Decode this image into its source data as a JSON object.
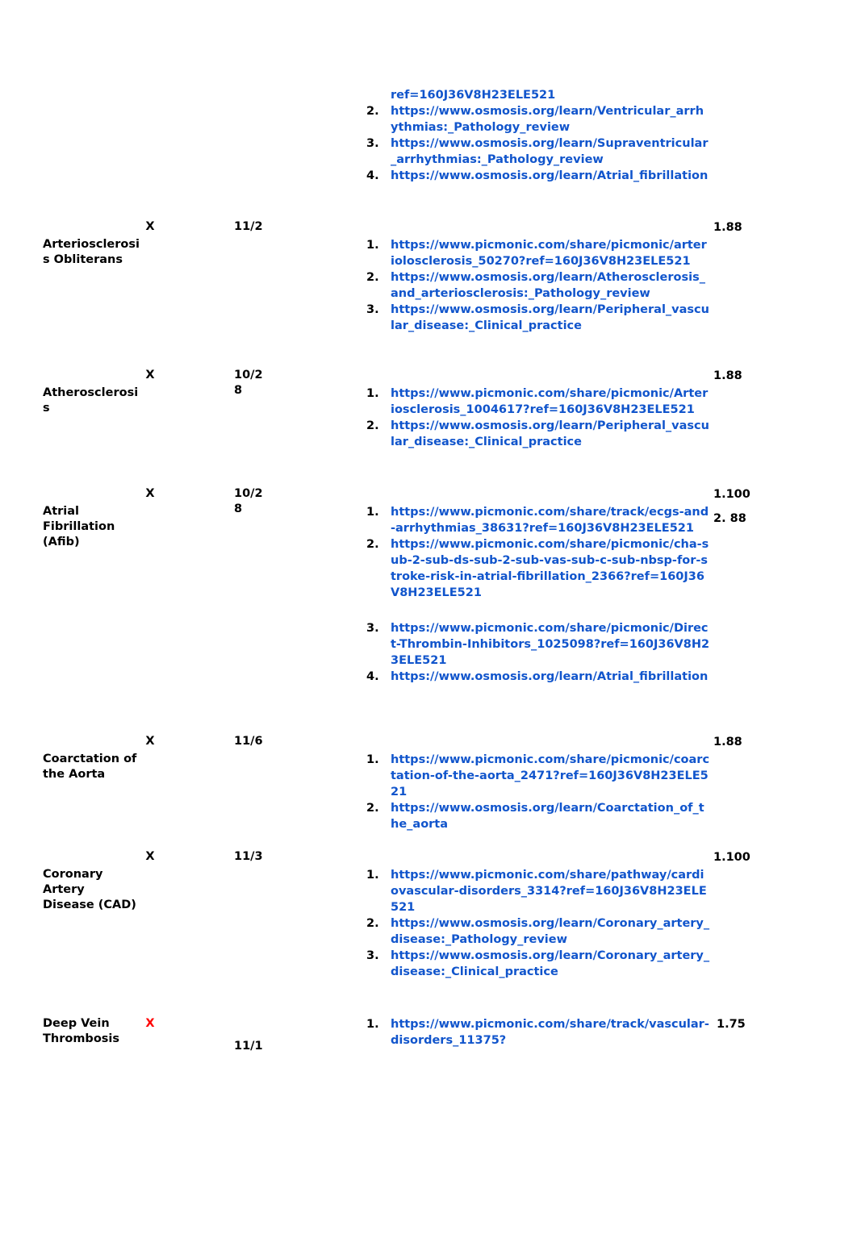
{
  "colors": {
    "link": "#1155cc",
    "text": "#000000",
    "flag_red": "#ff0000",
    "background": "#ffffff"
  },
  "rows": [
    {
      "id": "continuation",
      "topic": "",
      "mark": "",
      "date": "",
      "score": "",
      "links": [
        {
          "num": "",
          "url": "ref=160J36V8H23ELE521",
          "continuation": true
        },
        {
          "num": "2.",
          "url": "https://www.osmosis.org/learn/Ventricular_arrhythmias:_Pathology_review"
        },
        {
          "num": "3.",
          "url": "https://www.osmosis.org/learn/Supraventricular_arrhythmias:_Pathology_review"
        },
        {
          "num": "4.",
          "url": "https://www.osmosis.org/learn/Atrial_fibrillation"
        }
      ]
    },
    {
      "id": "arteriosclerosis-obliterans",
      "topic": "Arteriosclerosis Obliterans",
      "mark": "X",
      "mark_color": "black",
      "date": "11/2",
      "score": "1.88",
      "links": [
        {
          "num": "1.",
          "url": "https://www.picmonic.com/share/picmonic/arteriolosclerosis_50270?ref=160J36V8H23ELE521"
        },
        {
          "num": "2.",
          "url": "https://www.osmosis.org/learn/Atherosclerosis_and_arteriosclerosis:_Pathology_review"
        },
        {
          "num": "3.",
          "url": "https://www.osmosis.org/learn/Peripheral_vascular_disease:_Clinical_practice"
        }
      ]
    },
    {
      "id": "atherosclerosis",
      "topic": "Atherosclerosis",
      "mark": "X",
      "mark_color": "black",
      "date": "10/28",
      "score": "1.88",
      "links": [
        {
          "num": "1.",
          "url": "https://www.picmonic.com/share/picmonic/Arteriosclerosis_1004617?ref=160J36V8H23ELE521"
        },
        {
          "num": "2.",
          "url": "https://www.osmosis.org/learn/Peripheral_vascular_disease:_Clinical_practice"
        }
      ]
    },
    {
      "id": "atrial-fibrillation",
      "topic": "Atrial Fibrillation (Afib)",
      "mark": "X",
      "mark_color": "black",
      "date": "10/28",
      "score_lines": [
        "1.100",
        "2. 88"
      ],
      "links": [
        {
          "num": "1.",
          "url": "https://www.picmonic.com/share/track/ecgs-and-arrhythmias_38631?ref=160J36V8H23ELE521"
        },
        {
          "num": "2.",
          "url": "https://www.picmonic.com/share/picmonic/cha-sub-2-sub-ds-sub-2-sub-vas-sub-c-sub-nbsp-for-stroke-risk-in-atrial-fibrillation_2366?ref=160J36V8H23ELE521"
        },
        {
          "num": "3.",
          "url": "https://www.picmonic.com/share/picmonic/Direct-Thrombin-Inhibitors_1025098?ref=160J36V8H23ELE521",
          "gap_before": true
        },
        {
          "num": "4.",
          "url": "https://www.osmosis.org/learn/Atrial_fibrillation"
        }
      ]
    },
    {
      "id": "coarctation-of-the-aorta",
      "topic": "Coarctation of the Aorta",
      "mark": "X",
      "mark_color": "black",
      "date": "11/6",
      "score": "1.88",
      "links": [
        {
          "num": "1.",
          "url": "https://www.picmonic.com/share/picmonic/coarctation-of-the-aorta_2471?ref=160J36V8H23ELE521"
        },
        {
          "num": "2.",
          "url": "https://www.osmosis.org/learn/Coarctation_of_the_aorta"
        }
      ]
    },
    {
      "id": "coronary-artery-disease",
      "topic": "Coronary Artery Disease (CAD)",
      "mark": "X",
      "mark_color": "black",
      "date": "11/3",
      "score": "1.100",
      "links": [
        {
          "num": "1.",
          "url": "https://www.picmonic.com/share/pathway/cardiovascular-disorders_3314?ref=160J36V8H23ELE521"
        },
        {
          "num": "2.",
          "url": "https://www.osmosis.org/learn/Coronary_artery_disease:_Pathology_review"
        },
        {
          "num": "3.",
          "url": "https://www.osmosis.org/learn/Coronary_artery_disease:_Clinical_practice"
        }
      ]
    },
    {
      "id": "deep-vein-thrombosis",
      "topic": "Deep Vein Thrombosis",
      "mark": "X",
      "mark_color": "red",
      "date": "11/1",
      "score": "1.75",
      "links": [
        {
          "num": "1.",
          "url": "https://www.picmonic.com/share/track/vascular-disorders_11375?"
        }
      ]
    }
  ]
}
